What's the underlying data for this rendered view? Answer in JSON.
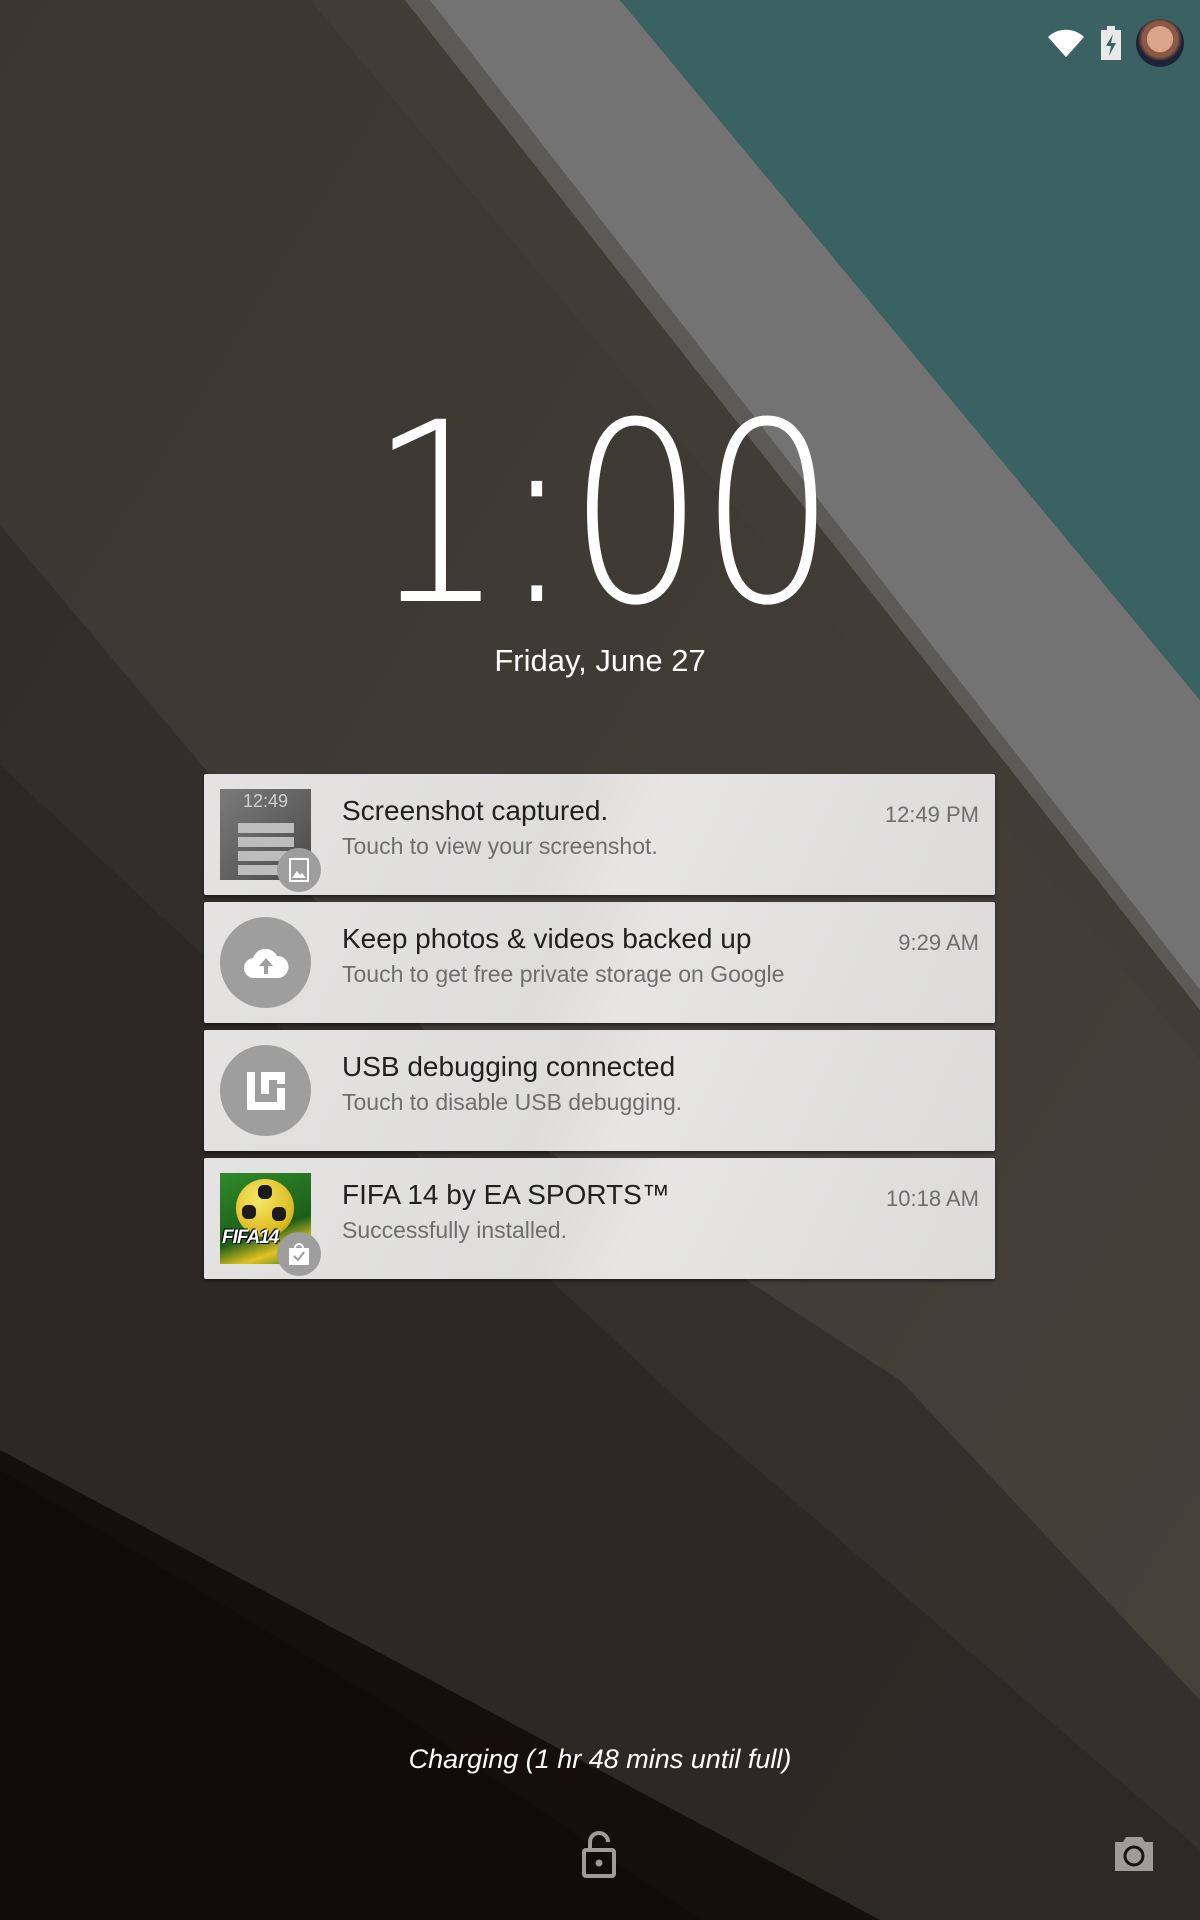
{
  "status_bar": {
    "icons": [
      "wifi-icon",
      "battery-charging-icon"
    ],
    "avatar": "user-avatar"
  },
  "lockscreen": {
    "time": "1:00",
    "date": "Friday, June 27"
  },
  "notifications": [
    {
      "icon": "screenshot-thumbnail",
      "badge_icon": "image-icon",
      "thumb_time": "12:49",
      "title": "Screenshot captured.",
      "text": "Touch to view your screenshot.",
      "time": "12:49 PM"
    },
    {
      "icon": "cloud-upload-icon",
      "title": "Keep photos & videos backed up",
      "text": "Touch to get free private storage on Google",
      "time": "9:29 AM"
    },
    {
      "icon": "usb-debugging-icon",
      "title": "USB debugging connected",
      "text": "Touch to disable USB debugging.",
      "time": ""
    },
    {
      "icon": "fifa-app-icon",
      "badge_icon": "play-store-bag-icon",
      "app_logo_text": "FIFA14",
      "title": "FIFA 14 by EA SPORTS™",
      "text": "Successfully installed.",
      "time": "10:18 AM"
    }
  ],
  "footer": {
    "charging_text": "Charging (1 hr 48 mins until full)",
    "unlock_icon": "unlock-icon",
    "camera_icon": "camera-icon"
  },
  "colors": {
    "teal": "#3a6262",
    "band_gray": "#737373",
    "olive": "#3d3930",
    "dark_brown": "#1a1210",
    "card_bg": "#e2e1e0",
    "icon_gray": "#9e9e9e"
  }
}
